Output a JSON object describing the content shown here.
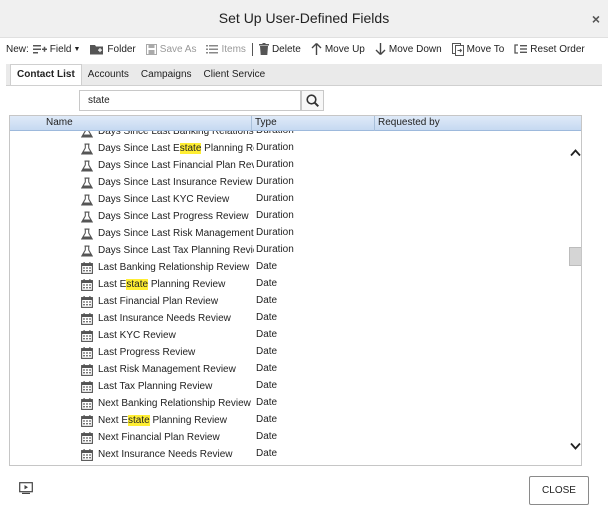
{
  "dialog": {
    "title": "Set Up User-Defined Fields",
    "close_glyph": "×"
  },
  "toolbar": {
    "new_label": "New:",
    "field_label": "Field",
    "folder_label": "Folder",
    "save_as_label": "Save As",
    "items_label": "Items",
    "delete_label": "Delete",
    "move_up_label": "Move Up",
    "move_down_label": "Move Down",
    "move_to_label": "Move To",
    "reset_order_label": "Reset Order"
  },
  "tabs": [
    "Contact List",
    "Accounts",
    "Campaigns",
    "Client Service"
  ],
  "search": {
    "value": "state",
    "highlight": "state"
  },
  "grid": {
    "columns": [
      "Name",
      "Type",
      "Requested by"
    ],
    "rows": [
      {
        "name": "Days Since Last Banking Relationship Review",
        "type": "Duration",
        "icon": "flask-icon"
      },
      {
        "name": "Days Since Last Estate Planning Review",
        "type": "Duration",
        "icon": "flask-icon"
      },
      {
        "name": "Days Since Last Financial Plan Review",
        "type": "Duration",
        "icon": "flask-icon"
      },
      {
        "name": "Days Since Last Insurance Review",
        "type": "Duration",
        "icon": "flask-icon"
      },
      {
        "name": "Days Since Last KYC Review",
        "type": "Duration",
        "icon": "flask-icon"
      },
      {
        "name": "Days Since Last Progress Review",
        "type": "Duration",
        "icon": "flask-icon"
      },
      {
        "name": "Days Since Last Risk Management Review",
        "type": "Duration",
        "icon": "flask-icon"
      },
      {
        "name": "Days Since Last Tax Planning Review",
        "type": "Duration",
        "icon": "flask-icon"
      },
      {
        "name": "Last Banking Relationship Review",
        "type": "Date",
        "icon": "calendar-icon"
      },
      {
        "name": "Last Estate Planning Review",
        "type": "Date",
        "icon": "calendar-icon"
      },
      {
        "name": "Last Financial Plan Review",
        "type": "Date",
        "icon": "calendar-icon"
      },
      {
        "name": "Last Insurance Needs Review",
        "type": "Date",
        "icon": "calendar-icon"
      },
      {
        "name": "Last KYC Review",
        "type": "Date",
        "icon": "calendar-icon"
      },
      {
        "name": "Last Progress Review",
        "type": "Date",
        "icon": "calendar-icon"
      },
      {
        "name": "Last Risk Management Review",
        "type": "Date",
        "icon": "calendar-icon"
      },
      {
        "name": "Last Tax Planning Review",
        "type": "Date",
        "icon": "calendar-icon"
      },
      {
        "name": "Next Banking Relationship Review",
        "type": "Date",
        "icon": "calendar-icon"
      },
      {
        "name": "Next Estate Planning Review",
        "type": "Date",
        "icon": "calendar-icon"
      },
      {
        "name": "Next Financial Plan Review",
        "type": "Date",
        "icon": "calendar-icon"
      },
      {
        "name": "Next Insurance Needs Review",
        "type": "Date",
        "icon": "calendar-icon"
      }
    ]
  },
  "footer": {
    "close_label": "CLOSE"
  },
  "colors": {
    "highlight": "#ffee33",
    "header_top": "#dfeaf8",
    "header_bottom": "#c6d9f1"
  }
}
